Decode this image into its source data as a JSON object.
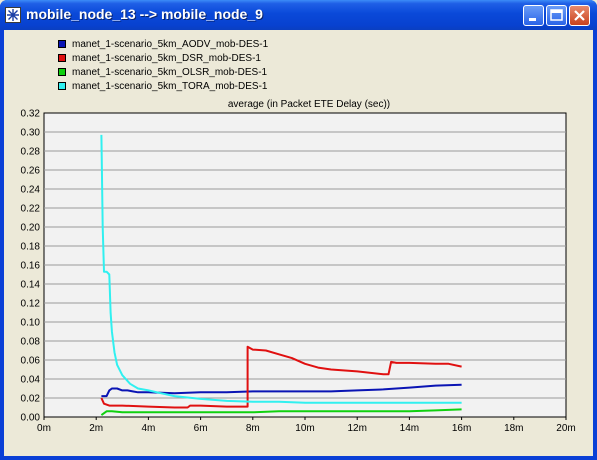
{
  "window": {
    "title": "mobile_node_13 --> mobile_node_9",
    "icon": "application-icon"
  },
  "titlebar_buttons": [
    "minimize-icon",
    "maximize-icon",
    "close-icon"
  ],
  "legend": [
    {
      "label": "manet_1-scenario_5km_AODV_mob-DES-1",
      "color": "#0A14B4"
    },
    {
      "label": "manet_1-scenario_5km_DSR_mob-DES-1",
      "color": "#E01010"
    },
    {
      "label": "manet_1-scenario_5km_OLSR_mob-DES-1",
      "color": "#10D010"
    },
    {
      "label": "manet_1-scenario_5km_TORA_mob-DES-1",
      "color": "#30F0F0"
    }
  ],
  "chart_data": {
    "type": "line",
    "title": "average (in Packet ETE Delay (sec))",
    "xlabel": "",
    "ylabel": "",
    "xlim": [
      0,
      20
    ],
    "ylim": [
      0,
      0.32
    ],
    "x_ticks": [
      "0m",
      "2m",
      "4m",
      "6m",
      "8m",
      "10m",
      "12m",
      "14m",
      "16m",
      "18m",
      "20m"
    ],
    "y_ticks": [
      "0.00",
      "0.02",
      "0.04",
      "0.06",
      "0.08",
      "0.10",
      "0.12",
      "0.14",
      "0.16",
      "0.18",
      "0.20",
      "0.22",
      "0.24",
      "0.26",
      "0.28",
      "0.30",
      "0.32"
    ],
    "grid": true,
    "series": [
      {
        "name": "manet_1-scenario_5km_AODV_mob-DES-1",
        "color": "#0A14B4",
        "points": [
          [
            2.2,
            0.022
          ],
          [
            2.4,
            0.022
          ],
          [
            2.5,
            0.028
          ],
          [
            2.6,
            0.03
          ],
          [
            2.8,
            0.03
          ],
          [
            3.0,
            0.028
          ],
          [
            3.2,
            0.028
          ],
          [
            3.4,
            0.027
          ],
          [
            3.6,
            0.026
          ],
          [
            4,
            0.026
          ],
          [
            5,
            0.025
          ],
          [
            6,
            0.026
          ],
          [
            7,
            0.026
          ],
          [
            8,
            0.027
          ],
          [
            9,
            0.027
          ],
          [
            10,
            0.027
          ],
          [
            11,
            0.027
          ],
          [
            12,
            0.028
          ],
          [
            13,
            0.029
          ],
          [
            14,
            0.031
          ],
          [
            15,
            0.033
          ],
          [
            16,
            0.034
          ]
        ]
      },
      {
        "name": "manet_1-scenario_5km_DSR_mob-DES-1",
        "color": "#E01010",
        "points": [
          [
            2.2,
            0.02
          ],
          [
            2.3,
            0.014
          ],
          [
            2.5,
            0.012
          ],
          [
            3,
            0.012
          ],
          [
            4,
            0.011
          ],
          [
            5,
            0.01
          ],
          [
            5.5,
            0.01
          ],
          [
            5.6,
            0.012
          ],
          [
            6,
            0.012
          ],
          [
            7,
            0.011
          ],
          [
            7.8,
            0.011
          ],
          [
            7.8,
            0.074
          ],
          [
            8,
            0.071
          ],
          [
            8.5,
            0.07
          ],
          [
            9,
            0.066
          ],
          [
            9.5,
            0.062
          ],
          [
            10,
            0.056
          ],
          [
            10.5,
            0.052
          ],
          [
            11,
            0.05
          ],
          [
            12,
            0.048
          ],
          [
            13,
            0.045
          ],
          [
            13.2,
            0.045
          ],
          [
            13.3,
            0.058
          ],
          [
            13.5,
            0.057
          ],
          [
            14,
            0.057
          ],
          [
            15,
            0.056
          ],
          [
            15.5,
            0.056
          ],
          [
            16,
            0.053
          ]
        ]
      },
      {
        "name": "manet_1-scenario_5km_OLSR_mob-DES-1",
        "color": "#10D010",
        "points": [
          [
            2.2,
            0.002
          ],
          [
            2.3,
            0.004
          ],
          [
            2.4,
            0.006
          ],
          [
            2.6,
            0.006
          ],
          [
            3,
            0.005
          ],
          [
            4,
            0.005
          ],
          [
            5,
            0.005
          ],
          [
            6,
            0.005
          ],
          [
            7,
            0.005
          ],
          [
            8,
            0.005
          ],
          [
            9,
            0.006
          ],
          [
            10,
            0.006
          ],
          [
            11,
            0.006
          ],
          [
            12,
            0.006
          ],
          [
            13,
            0.006
          ],
          [
            14,
            0.006
          ],
          [
            15,
            0.007
          ],
          [
            16,
            0.008
          ]
        ]
      },
      {
        "name": "manet_1-scenario_5km_TORA_mob-DES-1",
        "color": "#30F0F0",
        "points": [
          [
            2.2,
            0.297
          ],
          [
            2.25,
            0.2
          ],
          [
            2.3,
            0.153
          ],
          [
            2.4,
            0.153
          ],
          [
            2.5,
            0.15
          ],
          [
            2.55,
            0.11
          ],
          [
            2.6,
            0.09
          ],
          [
            2.7,
            0.068
          ],
          [
            2.8,
            0.055
          ],
          [
            3.0,
            0.044
          ],
          [
            3.3,
            0.035
          ],
          [
            3.6,
            0.03
          ],
          [
            4,
            0.028
          ],
          [
            4.5,
            0.025
          ],
          [
            5,
            0.022
          ],
          [
            6,
            0.019
          ],
          [
            7,
            0.017
          ],
          [
            8,
            0.016
          ],
          [
            9,
            0.016
          ],
          [
            10,
            0.015
          ],
          [
            11,
            0.015
          ],
          [
            12,
            0.015
          ],
          [
            13,
            0.015
          ],
          [
            14,
            0.015
          ],
          [
            15,
            0.015
          ],
          [
            16,
            0.015
          ]
        ]
      }
    ]
  }
}
